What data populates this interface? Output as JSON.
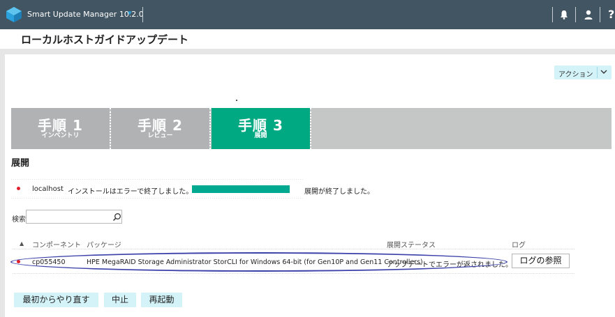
{
  "app": {
    "title": "Smart Update Manager 10.2.0"
  },
  "topbar": {
    "bell_icon": "bell-icon",
    "user_icon": "user-icon",
    "help": "?"
  },
  "page": {
    "title": "ローカルホストガイドアップデート"
  },
  "actions": {
    "label": "アクション"
  },
  "steps": [
    {
      "number": "手順 1",
      "label": "インベントリ"
    },
    {
      "number": "手順 2",
      "label": "レビュー"
    },
    {
      "number": "手順 3",
      "label": "展開"
    }
  ],
  "section": {
    "title": "展開"
  },
  "deploy_status": {
    "host": "localhost",
    "install_message": "インストールはエラーで終了しました。",
    "progress": 1.0,
    "status_text": "展開が終了しました。"
  },
  "search": {
    "label": "検索",
    "value": "",
    "placeholder": ""
  },
  "table": {
    "headers": {
      "component": "コンポーネント",
      "package": "パッケージ",
      "status": "展開ステータス",
      "log": "ログ"
    },
    "rows": [
      {
        "component": "cp055450",
        "package": "HPE MegaRAID Storage Administrator StorCLI for Windows 64-bit (for Gen10P and Gen11 Controllers)",
        "status": "アップデートでエラーが返されました。",
        "log_button": "ログの参照"
      }
    ]
  },
  "buttons": {
    "restart_from_beginning": "最初からやり直す",
    "abort": "中止",
    "reboot": "再起動"
  },
  "colors": {
    "topbar": "#425563",
    "step_active": "#01a982",
    "step_inactive": "#b0b2b3",
    "button_bg": "#d3f3f8",
    "error": "#e0202b",
    "highlight": "#3b41a8"
  }
}
